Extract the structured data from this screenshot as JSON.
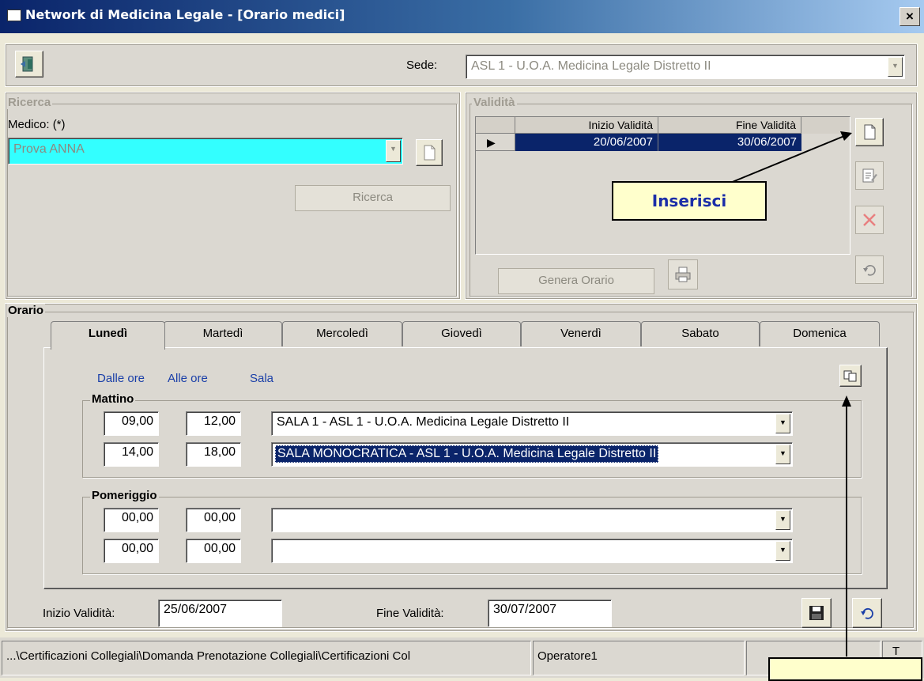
{
  "window": {
    "title": "Network di Medicina Legale - [Orario medici]",
    "close_label": "×"
  },
  "toolbar": {
    "sede_label": "Sede:",
    "sede_value": "ASL 1 - U.O.A. Medicina Legale Distretto II"
  },
  "ricerca": {
    "group_label": "Ricerca",
    "medico_label": "Medico: (*)",
    "medico_value": "Prova ANNA",
    "search_button": "Ricerca"
  },
  "validita": {
    "group_label": "Validità",
    "columns": [
      "Inizio Validità",
      "Fine Validità"
    ],
    "rows": [
      {
        "inizio": "20/06/2007",
        "fine": "30/06/2007"
      }
    ],
    "genera_button": "Genera Orario"
  },
  "orario": {
    "group_label": "Orario",
    "tabs": [
      "Lunedì",
      "Martedì",
      "Mercoledì",
      "Giovedì",
      "Venerdì",
      "Sabato",
      "Domenica"
    ],
    "active_tab": "Lunedì",
    "headers": {
      "dalle": "Dalle ore",
      "alle": "Alle ore",
      "sala": "Sala"
    },
    "mattino": {
      "label": "Mattino",
      "rows": [
        {
          "dalle": "09,00",
          "alle": "12,00",
          "sala": "SALA 1  -  ASL 1 - U.O.A. Medicina Legale Distretto II"
        },
        {
          "dalle": "14,00",
          "alle": "18,00",
          "sala": "SALA MONOCRATICA  -  ASL 1 - U.O.A. Medicina Legale Distretto II"
        }
      ]
    },
    "pomeriggio": {
      "label": "Pomeriggio",
      "rows": [
        {
          "dalle": "00,00",
          "alle": "00,00",
          "sala": ""
        },
        {
          "dalle": "00,00",
          "alle": "00,00",
          "sala": ""
        }
      ]
    }
  },
  "footer": {
    "inizio_label": "Inizio Validità:",
    "inizio_value": "25/06/2007",
    "fine_label": "Fine Validità:",
    "fine_value": "30/07/2007"
  },
  "status": {
    "path": "...\\Certificazioni Collegiali\\Domanda Prenotazione Collegiali\\Certificazioni Col",
    "operator": "Operatore1",
    "extra": "T"
  },
  "callouts": {
    "inserisci": "Inserisci",
    "copy": ""
  },
  "icons": {
    "exit": "exit-door-icon",
    "new": "new-document-icon",
    "edit": "edit-icon",
    "delete": "delete-x-icon",
    "undo": "undo-icon",
    "print": "printer-icon",
    "save": "floppy-save-icon",
    "copy": "copy-icon"
  },
  "colors": {
    "selected_row": "#0a246a",
    "medico_bg": "#33ffff",
    "callout_text": "#1b2ea8",
    "callout_bg": "#ffffcc"
  }
}
